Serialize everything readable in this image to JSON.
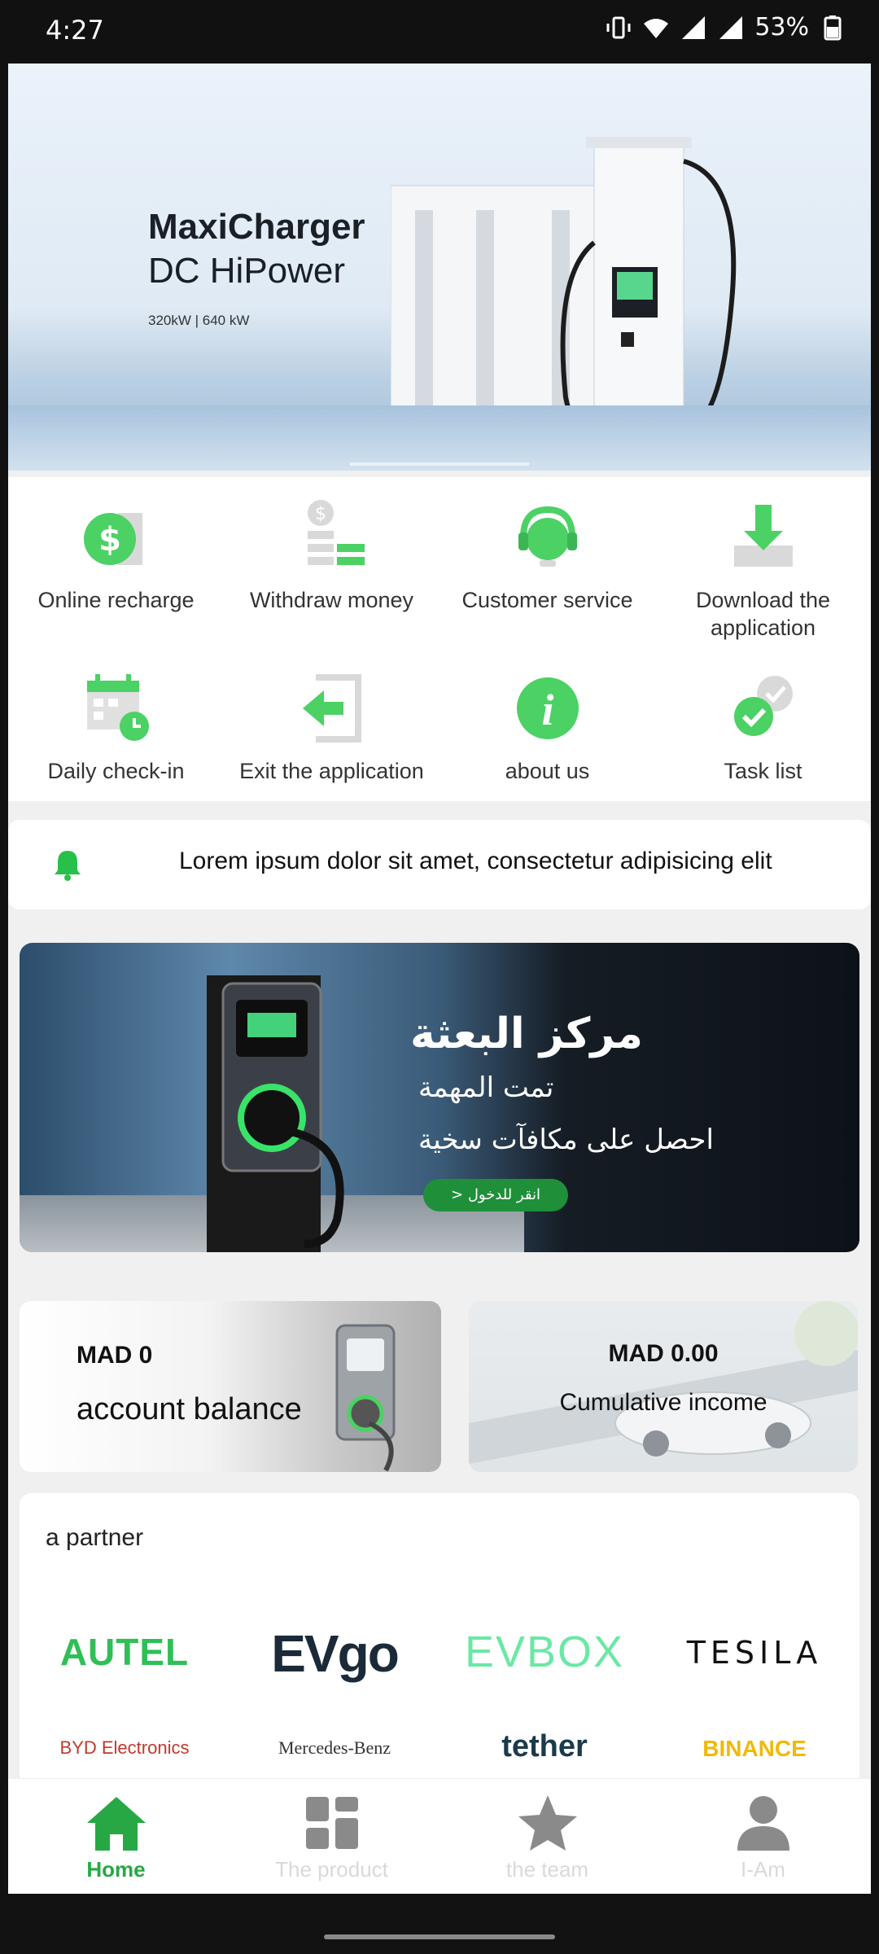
{
  "status_bar": {
    "time": "4:27",
    "battery": "53%"
  },
  "hero": {
    "title_line1": "MaxiCharger",
    "title_line2": "DC HiPower",
    "spec": "320kW | 640 kW"
  },
  "menu": [
    {
      "label": "Online recharge",
      "icon": "dollar-coin-icon"
    },
    {
      "label": "Withdraw money",
      "icon": "withdraw-icon"
    },
    {
      "label": "Customer service",
      "icon": "headset-icon"
    },
    {
      "label": "Download the application",
      "icon": "download-icon"
    },
    {
      "label": "Daily check-in",
      "icon": "calendar-icon"
    },
    {
      "label": "Exit the application",
      "icon": "exit-icon"
    },
    {
      "label": "about us",
      "icon": "info-icon"
    },
    {
      "label": "Task list",
      "icon": "checklist-icon"
    }
  ],
  "notice": {
    "text": "Lorem ipsum dolor sit amet, consectetur adipisicing elit"
  },
  "promo": {
    "line1": "مركز البعثة",
    "line2": "تمت المهمة",
    "line3": "احصل على مكافآت سخية",
    "button": "انقر للدخول  <"
  },
  "balance": {
    "account_amount": "MAD 0",
    "account_label": "account balance",
    "income_amount": "MAD 0.00",
    "income_label": "Cumulative income"
  },
  "partner": {
    "heading": "a partner",
    "logos": [
      "AUTEL",
      "EVgo",
      "EVBOX",
      "TESILA",
      "BYD Electronics",
      "Mercedes-Benz",
      "tether",
      "BINANCE"
    ]
  },
  "nav": [
    {
      "label": "Home",
      "icon": "home-icon",
      "active": true
    },
    {
      "label": "The product",
      "icon": "grid-icon",
      "active": false
    },
    {
      "label": "the team",
      "icon": "star-icon",
      "active": false
    },
    {
      "label": "I-Am",
      "icon": "user-icon",
      "active": false
    }
  ],
  "colors": {
    "accent": "#27a844",
    "menu_green": "#4cd164"
  }
}
